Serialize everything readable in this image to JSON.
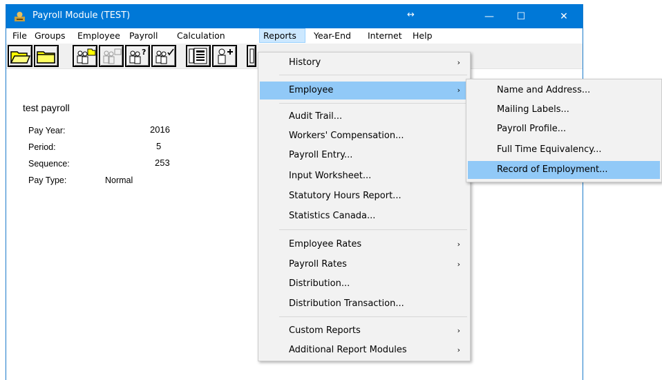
{
  "window": {
    "title": "Payroll Module  (TEST)",
    "resize_glyph": "↔",
    "minimize_glyph": "—",
    "maximize_glyph": "☐",
    "close_glyph": "✕",
    "titlebar_color": "#0078d7"
  },
  "menubar": {
    "items": [
      {
        "label": "File"
      },
      {
        "label": "Groups"
      },
      {
        "label": "Employee"
      },
      {
        "label": "Payroll"
      },
      {
        "label": "Calculation"
      },
      {
        "label": "Reports"
      },
      {
        "label": "Year-End"
      },
      {
        "label": "Internet"
      },
      {
        "label": "Help"
      }
    ],
    "active": "Reports"
  },
  "toolbar": {
    "buttons": [
      {
        "icon": "open-folder-icon"
      },
      {
        "icon": "folder-icon"
      },
      {
        "icon": "group-open-icon"
      },
      {
        "icon": "group-disabled-icon"
      },
      {
        "icon": "group-query-icon"
      },
      {
        "icon": "group-check-icon"
      },
      {
        "icon": "employee-list-icon"
      },
      {
        "icon": "add-employee-icon"
      },
      {
        "icon": "partial-icon"
      }
    ]
  },
  "info": {
    "heading": "test payroll",
    "pay_year_label": "Pay Year:",
    "pay_year_value": "2016",
    "period_label": "Period:",
    "period_value": "5",
    "sequence_label": "Sequence:",
    "sequence_value": "253",
    "pay_type_label": "Pay Type:",
    "pay_type_value": "Normal"
  },
  "reports_menu": {
    "items": [
      {
        "label": "History",
        "submenu": true
      },
      {
        "label": "Employee",
        "submenu": true,
        "highlighted": true
      },
      {
        "label": "Audit Trail..."
      },
      {
        "label": "Workers' Compensation..."
      },
      {
        "label": "Payroll Entry..."
      },
      {
        "label": "Input Worksheet..."
      },
      {
        "label": "Statutory Hours Report..."
      },
      {
        "label": "Statistics Canada..."
      },
      {
        "label": "Employee Rates",
        "submenu": true
      },
      {
        "label": "Payroll Rates",
        "submenu": true
      },
      {
        "label": "Distribution..."
      },
      {
        "label": "Distribution Transaction..."
      },
      {
        "label": "Custom Reports",
        "submenu": true
      },
      {
        "label": "Additional Report Modules",
        "submenu": true
      }
    ],
    "arrow_glyph": "›"
  },
  "employee_submenu": {
    "items": [
      {
        "label": "Name and Address..."
      },
      {
        "label": "Mailing Labels..."
      },
      {
        "label": "Payroll Profile..."
      },
      {
        "label": "Full Time Equivalency..."
      },
      {
        "label": "Record of Employment...",
        "highlighted": true
      }
    ]
  },
  "colors": {
    "menu_highlight": "#91c9f7",
    "menubar_active": "#cce8ff"
  }
}
